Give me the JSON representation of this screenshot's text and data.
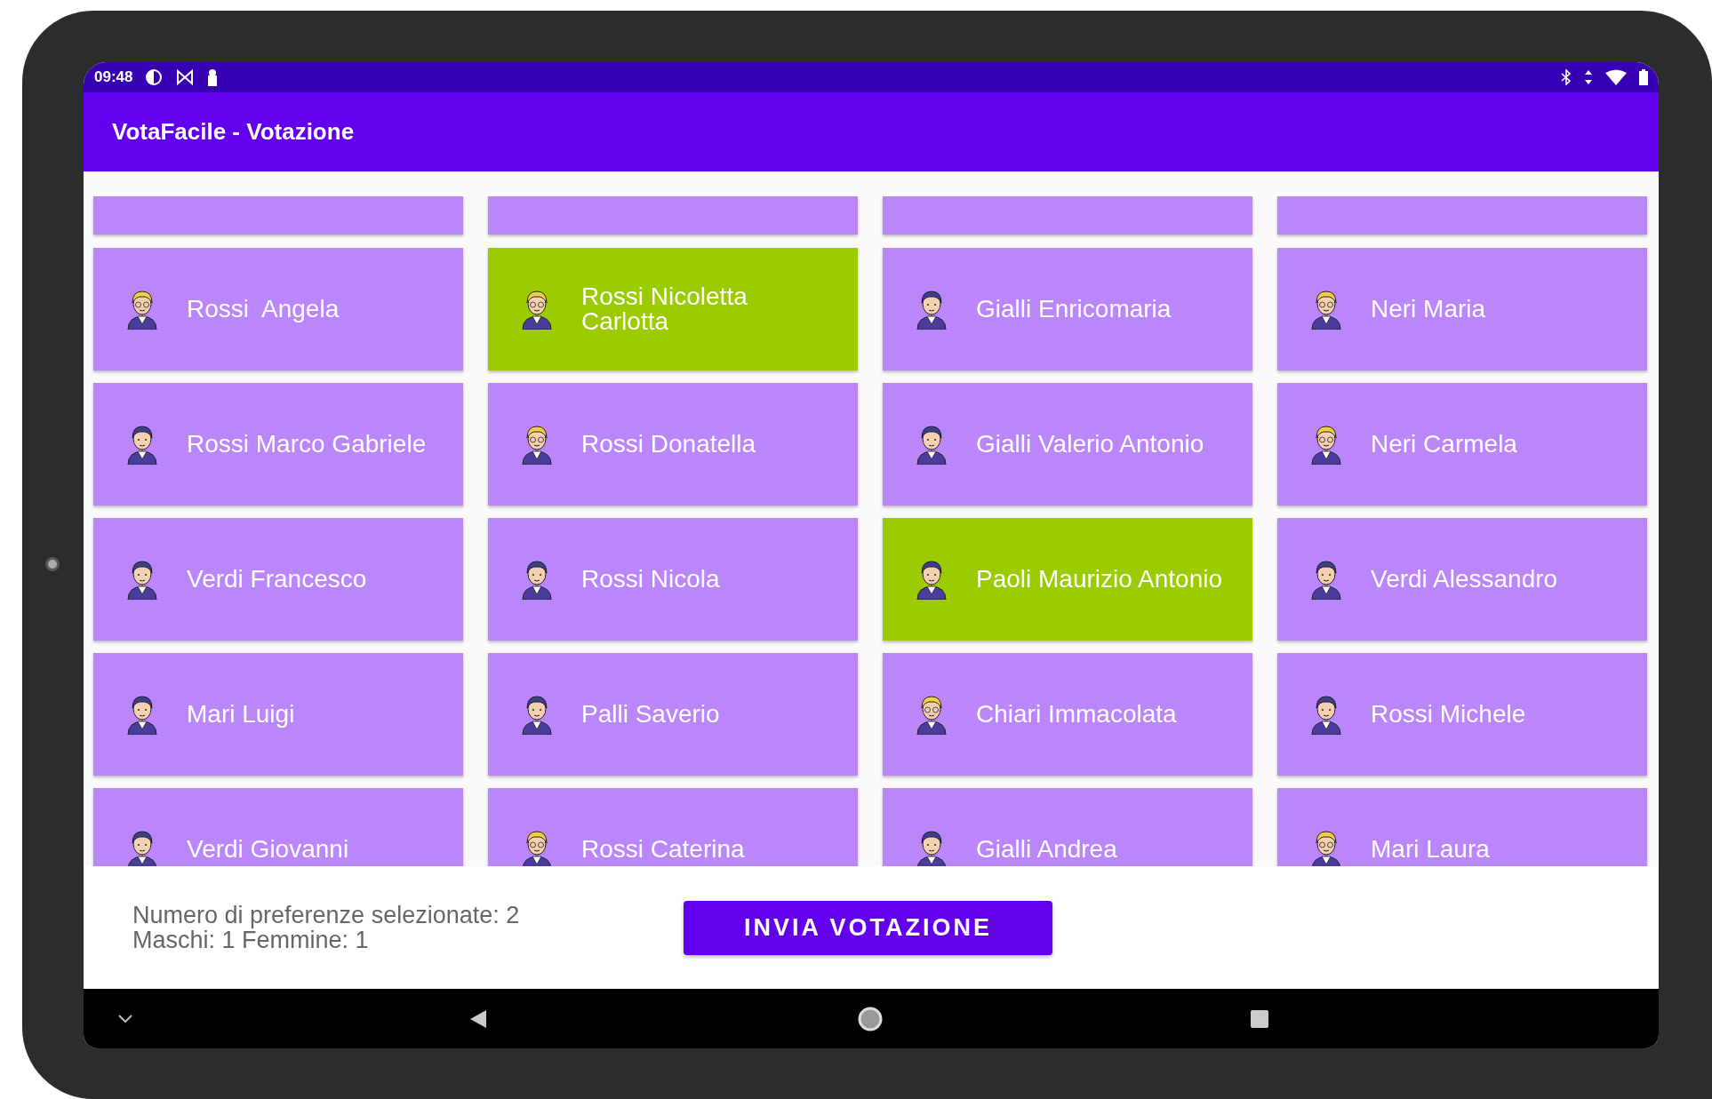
{
  "status_bar": {
    "time": "09:48"
  },
  "app_bar": {
    "title": "VotaFacile - Votazione"
  },
  "clipped_cards": [
    {
      "selected": false
    },
    {
      "selected": false
    },
    {
      "selected": false
    },
    {
      "selected": false
    }
  ],
  "candidates": [
    {
      "name": "Rossi  Angela",
      "kind": "female",
      "selected": false
    },
    {
      "name": "Rossi Nicoletta Carlotta",
      "kind": "female",
      "selected": true
    },
    {
      "name": "Gialli Enricomaria",
      "kind": "male",
      "selected": false
    },
    {
      "name": "Neri Maria",
      "kind": "female",
      "selected": false
    },
    {
      "name": "Rossi Marco Gabriele",
      "kind": "male",
      "selected": false
    },
    {
      "name": "Rossi Donatella",
      "kind": "female",
      "selected": false
    },
    {
      "name": "Gialli Valerio Antonio",
      "kind": "male",
      "selected": false
    },
    {
      "name": "Neri Carmela",
      "kind": "female",
      "selected": false
    },
    {
      "name": "Verdi Francesco",
      "kind": "male",
      "selected": false
    },
    {
      "name": "Rossi Nicola",
      "kind": "male",
      "selected": false
    },
    {
      "name": "Paoli Maurizio Antonio",
      "kind": "male",
      "selected": true
    },
    {
      "name": "Verdi Alessandro",
      "kind": "male",
      "selected": false
    },
    {
      "name": "Mari Luigi",
      "kind": "male",
      "selected": false
    },
    {
      "name": "Palli Saverio",
      "kind": "male",
      "selected": false
    },
    {
      "name": "Chiari Immacolata",
      "kind": "female",
      "selected": false
    },
    {
      "name": "Rossi Michele",
      "kind": "male",
      "selected": false
    },
    {
      "name": "Verdi Giovanni",
      "kind": "male",
      "selected": false
    },
    {
      "name": "Rossi Caterina",
      "kind": "female",
      "selected": false
    },
    {
      "name": "Gialli Andrea",
      "kind": "male",
      "selected": false
    },
    {
      "name": "Mari Laura",
      "kind": "female",
      "selected": false
    }
  ],
  "footer": {
    "count_text": "Numero di preferenze selezionate: 2",
    "gender_text": "Maschi: 1 Femmine: 1",
    "submit_button": "INVIA VOTAZIONE"
  }
}
